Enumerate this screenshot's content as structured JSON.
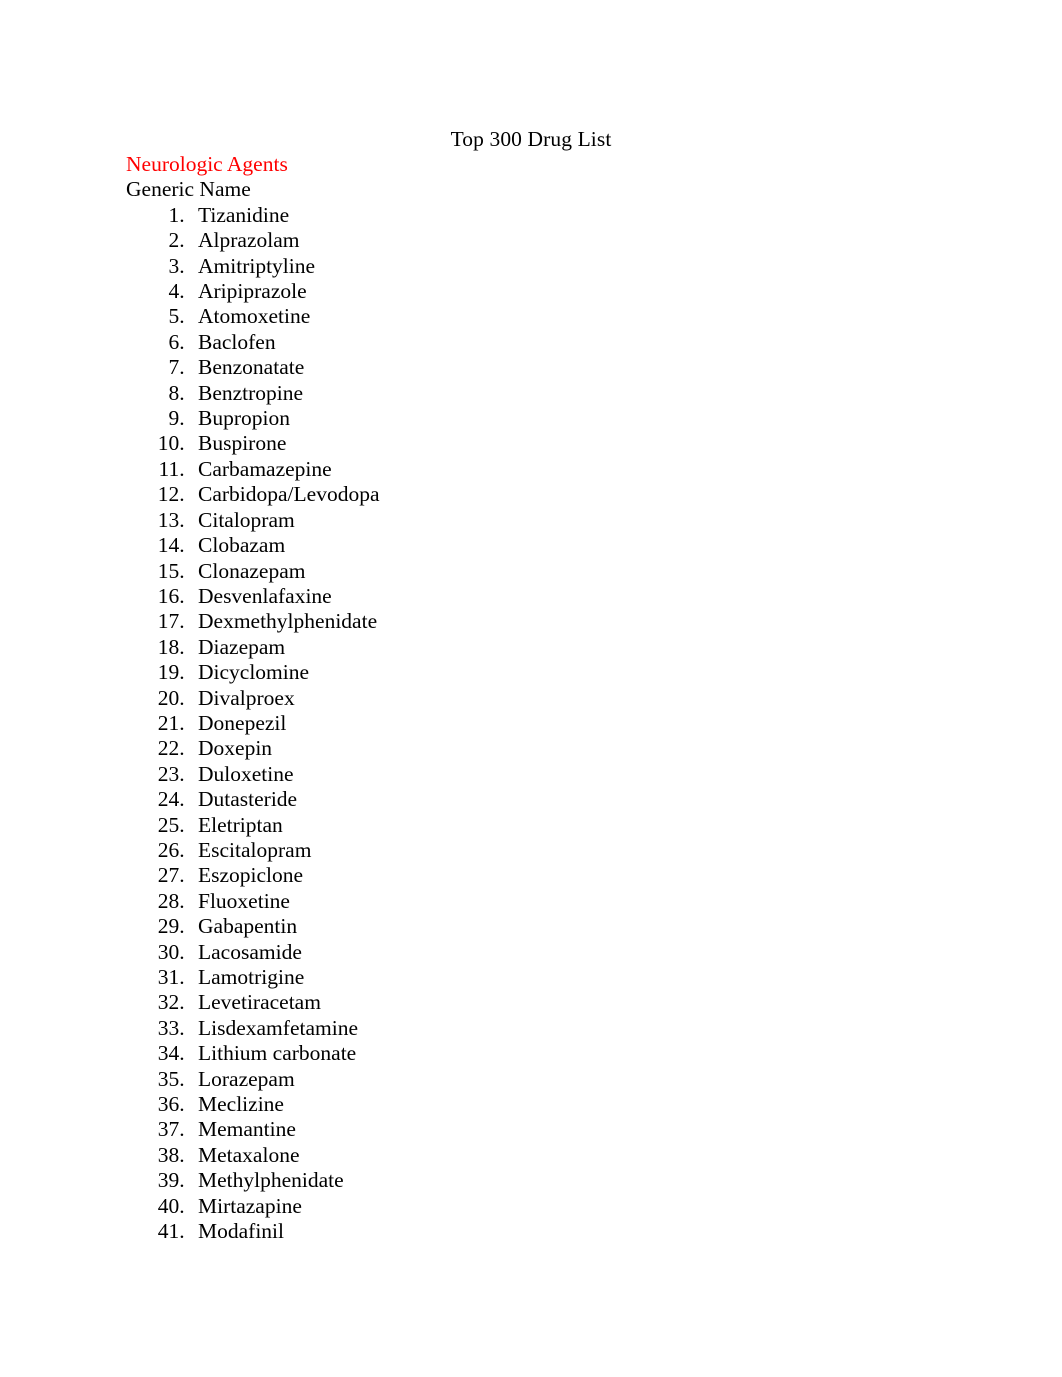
{
  "document": {
    "title": "Top 300 Drug List",
    "section_heading": "Neurologic Agents",
    "column_label": "Generic Name",
    "heading_color": "#ff0000",
    "text_color": "#000000",
    "page_background": "#ffffff"
  },
  "drug_list": [
    "Tizanidine",
    "Alprazolam",
    "Amitriptyline",
    "Aripiprazole",
    "Atomoxetine",
    "Baclofen",
    "Benzonatate",
    "Benztropine",
    "Bupropion",
    "Buspirone",
    "Carbamazepine",
    "Carbidopa/Levodopa",
    "Citalopram",
    "Clobazam",
    "Clonazepam",
    "Desvenlafaxine",
    "Dexmethylphenidate",
    "Diazepam",
    "Dicyclomine",
    "Divalproex",
    "Donepezil",
    "Doxepin",
    "Duloxetine",
    "Dutasteride",
    "Eletriptan",
    "Escitalopram",
    "Eszopiclone",
    "Fluoxetine",
    "Gabapentin",
    "Lacosamide",
    "Lamotrigine",
    "Levetiracetam",
    "Lisdexamfetamine",
    "Lithium carbonate",
    "Lorazepam",
    "Meclizine",
    "Memantine",
    "Metaxalone",
    "Methylphenidate",
    "Mirtazapine",
    "Modafinil"
  ]
}
